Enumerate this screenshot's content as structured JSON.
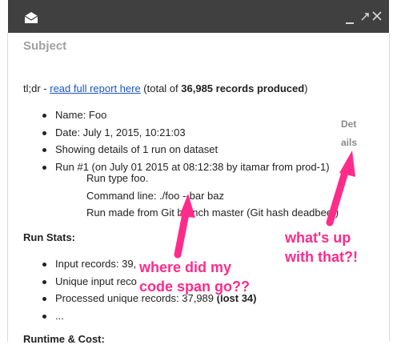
{
  "window": {
    "title_icon": "envelope-open-icon",
    "controls": [
      "minimize-icon",
      "maximize-icon",
      "close-icon"
    ],
    "bar_color": "#404040"
  },
  "email": {
    "subject": "Subject",
    "tldr_prefix": "tl;dr - ",
    "tldr_link": "read full report here",
    "tldr_mid": " (total of ",
    "tldr_bold": "36,985 records produced",
    "tldr_suffix": ")",
    "summary_items": [
      "Name: Foo",
      "Date: July 1, 2015, 10:21:03",
      "Showing details of 1 run on dataset",
      "Run #1 (on July 01 2015 at 08:12:38 by itamar from prod-1)"
    ],
    "run_items": [
      "Run type foo.",
      "Command line: ./foo --bar baz",
      "Run made from Git branch master (Git hash deadbeef)"
    ],
    "details_label": "Details",
    "details_part1": "Det",
    "details_part2": "ails",
    "run_stats_title": "Run Stats:",
    "run_stats": {
      "input_records": "Input records: 39,",
      "unique_input": "Unique input reco",
      "processed_prefix": "Processed unique records: 37,989 ",
      "processed_bold": "(lost 34)",
      "ellipsis": "..."
    },
    "runtime_title": "Runtime & Cost:"
  },
  "annotations": {
    "code_span_line1": "where did my",
    "code_span_line2": "code span go??",
    "details_line1": "what's up",
    "details_line2": "with that?!",
    "color": "#ff2b8a"
  }
}
